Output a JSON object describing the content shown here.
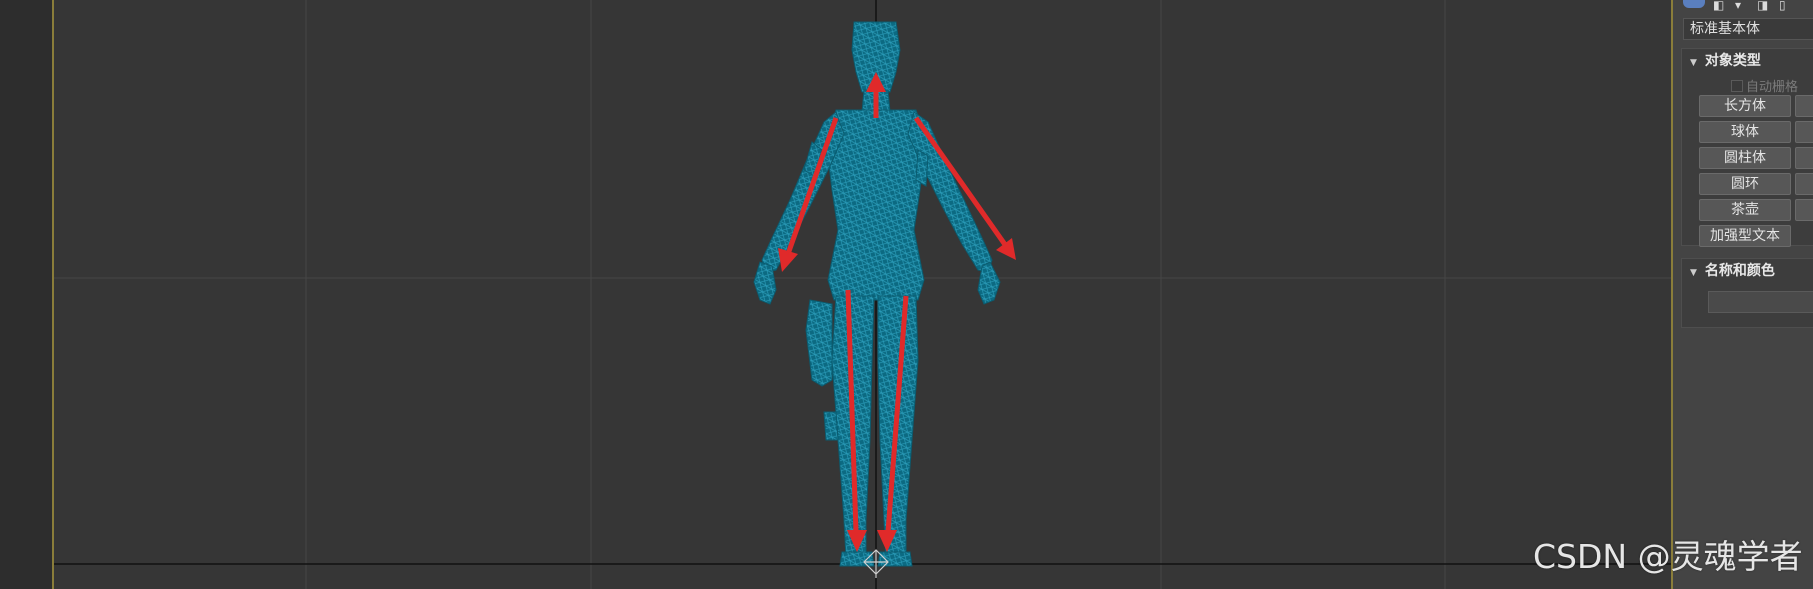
{
  "panel": {
    "dropdown_value": "标准基本体",
    "object_type": {
      "header": "对象类型",
      "auto_grid_label": "自动栅格",
      "buttons": [
        "长方体",
        "球体",
        "圆柱体",
        "圆环",
        "茶壶",
        "加强型文本"
      ]
    },
    "name_color": {
      "header": "名称和颜色"
    }
  },
  "watermark": "CSDN @灵魂学者",
  "colors": {
    "viewport_bg": "#363636",
    "wireframe": "#0e6e86",
    "arrow": "#e02a2a",
    "frame_gold": "#8a7d3a"
  },
  "icons": [
    "create-tab-icon",
    "modify-tab-icon",
    "hierarchy-tab-icon",
    "motion-tab-icon",
    "display-tab-icon"
  ]
}
